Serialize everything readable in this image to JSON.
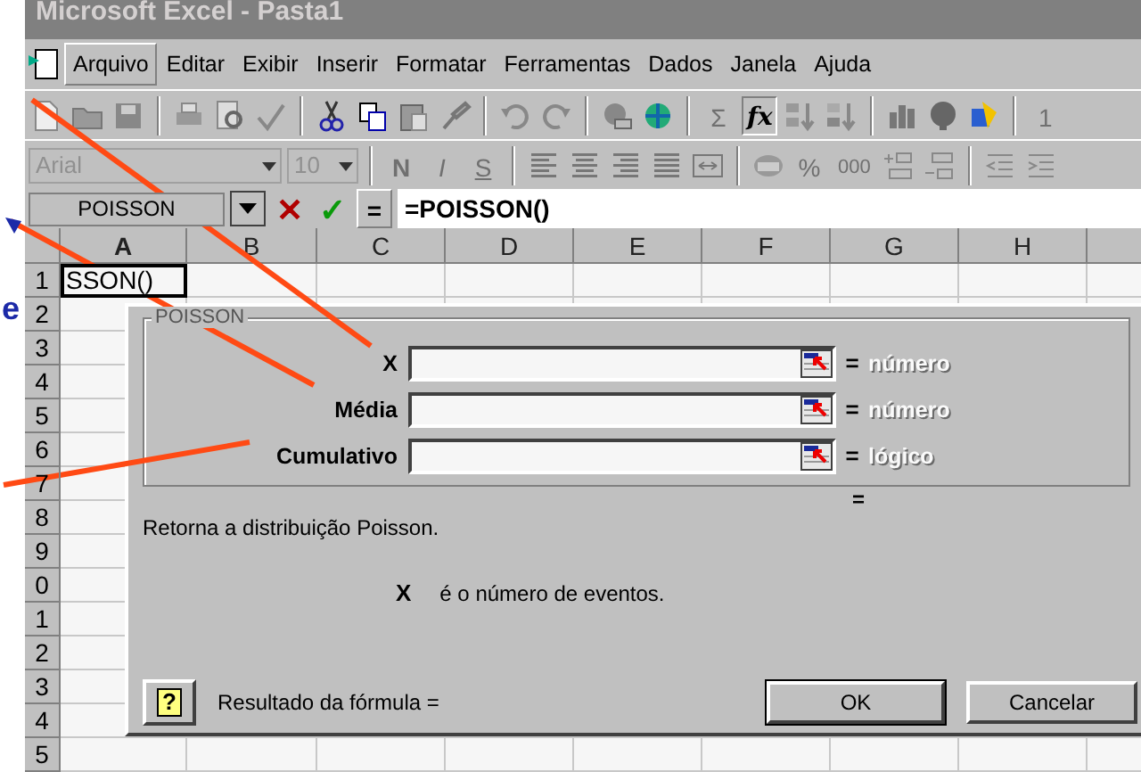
{
  "side_text": "e",
  "window": {
    "title": "Microsoft Excel - Pasta1"
  },
  "menu": [
    {
      "label": "Arquivo",
      "selected": true
    },
    {
      "label": "Editar",
      "selected": false
    },
    {
      "label": "Exibir",
      "selected": false
    },
    {
      "label": "Inserir",
      "selected": false
    },
    {
      "label": "Formatar",
      "selected": false
    },
    {
      "label": "Ferramentas",
      "selected": false
    },
    {
      "label": "Dados",
      "selected": false
    },
    {
      "label": "Janela",
      "selected": false
    },
    {
      "label": "Ajuda",
      "selected": false
    }
  ],
  "standard_toolbar": {
    "sum": "Σ",
    "function": "fx",
    "function_pressed": true,
    "zoom": "1"
  },
  "formatting_toolbar": {
    "font": "Arial",
    "size": "10",
    "bold": "N",
    "italic": "I",
    "underline": "S",
    "percent": "%",
    "thousands": "000"
  },
  "formula_bar": {
    "name_box": "POISSON",
    "cancel": "✕",
    "enter": "✓",
    "equals": "=",
    "formula": "=POISSON()"
  },
  "sheet": {
    "columns": [
      {
        "label": "A",
        "selected": true
      },
      {
        "label": "B",
        "selected": false
      },
      {
        "label": "C",
        "selected": false
      },
      {
        "label": "D",
        "selected": false
      },
      {
        "label": "E",
        "selected": false
      },
      {
        "label": "F",
        "selected": false
      },
      {
        "label": "G",
        "selected": false
      },
      {
        "label": "H",
        "selected": false
      }
    ],
    "rows": [
      "1",
      "2",
      "3",
      "4",
      "5",
      "6",
      "7",
      "8",
      "9",
      "0",
      "1",
      "2",
      "3",
      "4",
      "5"
    ],
    "cell_a1": "SSON()"
  },
  "dialog": {
    "group_title": "POISSON",
    "arguments": [
      {
        "label": "X",
        "equals": "=",
        "result": "número"
      },
      {
        "label": "Média",
        "equals": "=",
        "result": "número"
      },
      {
        "label": "Cumulativo",
        "equals": "=",
        "result": "lógico"
      }
    ],
    "result_equals": "=",
    "description": "Retorna a distribuição Poisson.",
    "argument_name": "X",
    "argument_description": "é o número de eventos.",
    "formula_result": "Resultado da fórmula =",
    "help_glyph": "?",
    "buttons": [
      "OK",
      "Cancelar"
    ]
  }
}
